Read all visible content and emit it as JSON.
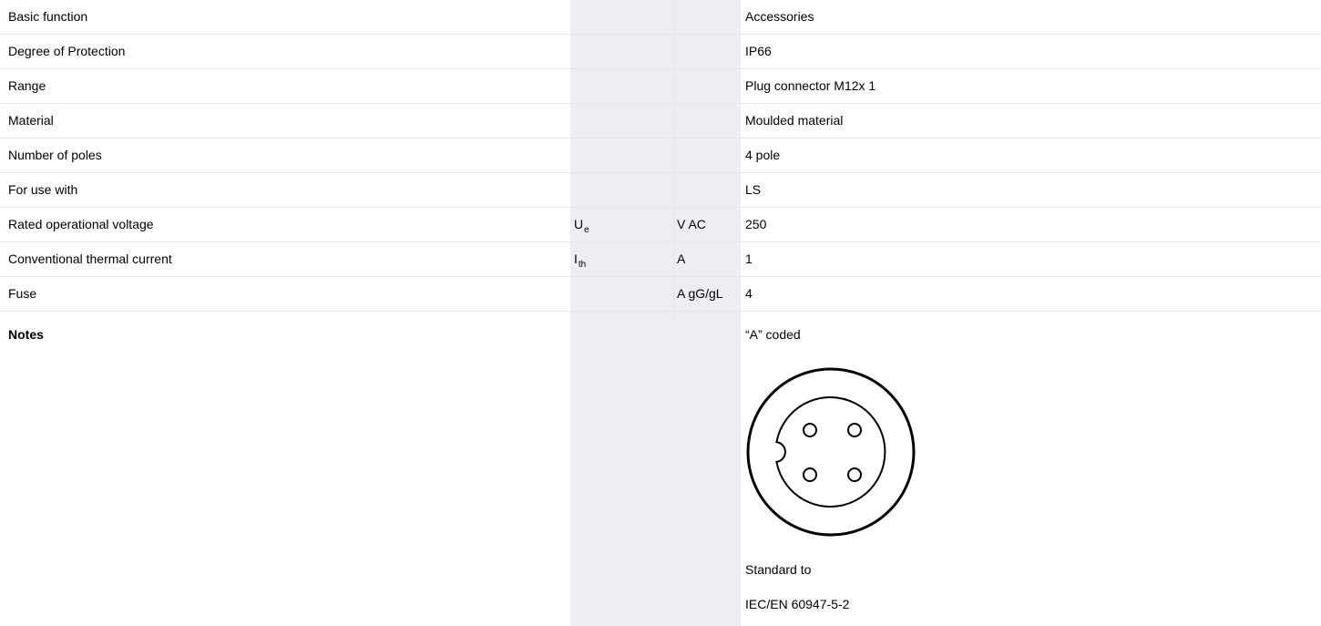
{
  "rows": [
    {
      "name": "Basic function",
      "symbol": "",
      "symbol_sub": "",
      "unit": "",
      "value": "Accessories"
    },
    {
      "name": "Degree of Protection",
      "symbol": "",
      "symbol_sub": "",
      "unit": "",
      "value": "IP66"
    },
    {
      "name": "Range",
      "symbol": "",
      "symbol_sub": "",
      "unit": "",
      "value": "Plug connector M12x 1"
    },
    {
      "name": "Material",
      "symbol": "",
      "symbol_sub": "",
      "unit": "",
      "value": "Moulded material"
    },
    {
      "name": "Number of poles",
      "symbol": "",
      "symbol_sub": "",
      "unit": "",
      "value": "4 pole"
    },
    {
      "name": "For use with",
      "symbol": "",
      "symbol_sub": "",
      "unit": "",
      "value": "LS"
    },
    {
      "name": "Rated operational voltage",
      "symbol": "U",
      "symbol_sub": "e",
      "unit": "V AC",
      "value": "250"
    },
    {
      "name": "Conventional thermal current",
      "symbol": "I",
      "symbol_sub": "th",
      "unit": "A",
      "value": "1"
    },
    {
      "name": "Fuse",
      "symbol": "",
      "symbol_sub": "",
      "unit": "A gG/gL",
      "value": "4"
    }
  ],
  "notes": {
    "label": "Notes",
    "coded": "“A” coded",
    "standard_line1": "Standard to",
    "standard_line2": "IEC/EN 60947-5-2",
    "diagram_icon": "m12-a-coded-4-pole-connector-face"
  },
  "colors": {
    "shaded_column": "#eceef1",
    "row_divider": "#e6e6e6"
  }
}
